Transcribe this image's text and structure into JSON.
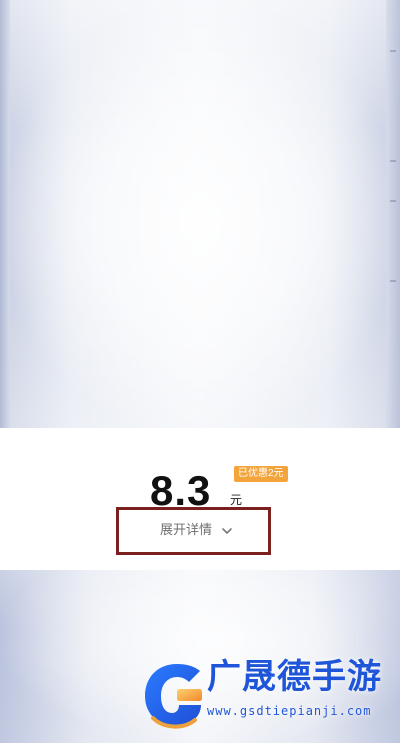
{
  "price": {
    "amount": "8.3",
    "unit": "元",
    "discount_badge": "已优惠2元"
  },
  "details": {
    "label": "展开详情",
    "chevron_icon": "chevron-down-icon"
  },
  "watermark": {
    "title": "广晟德手游",
    "url": "www.gsdtiepianji.com",
    "logo_icon": "brand-logo-icon",
    "brand_color": "#1f55d8",
    "accent_color": "#f0a03a"
  },
  "colors": {
    "badge_bg": "#f3a43a",
    "highlight_border": "#7b1f1f"
  }
}
